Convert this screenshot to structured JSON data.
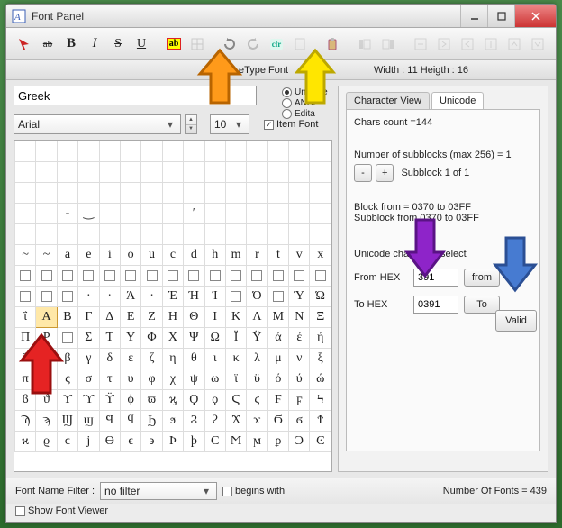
{
  "window": {
    "title": "Font Panel"
  },
  "infobar": {
    "center_label": "eType Font",
    "dims": "Width : 11  Heigth : 16"
  },
  "toolbar_glyphs": {
    "cross_ab": "ab",
    "clr": "clr"
  },
  "left": {
    "block_name": "Greek",
    "font_family": "Arial",
    "font_size": "10",
    "radios": {
      "unicode": "Unicode",
      "ansi": "ANSI",
      "editable": "Edita"
    },
    "item_font_label": "Item Font",
    "item_font_checked": true
  },
  "tabs": {
    "char_view": "Character View",
    "unicode": "Unicode"
  },
  "right": {
    "chars_count_label": "Chars count =",
    "chars_count_value": "144",
    "subblocks_label": "Number of subblocks (max 256)  =",
    "subblocks_value": "1",
    "subblock_text": "Subblock 1 of 1",
    "block_range": "Block from = 0370 to 03FF",
    "subblock_range": "Subblock from 0370 to 03FF",
    "class_select_label": "Unicode char class select",
    "from_hex_label": "From HEX",
    "from_hex_value": "391",
    "from_btn": "from",
    "to_hex_label": "To HEX",
    "to_hex_value": "0391",
    "to_btn": "To",
    "valid_btn": "Valid"
  },
  "bottom": {
    "font_filter_label": "Font Name Filter :",
    "filter_value": "no filter",
    "begins_with": "begins with",
    "num_fonts_label": "Number Of Fonts =",
    "num_fonts_value": "439",
    "show_font_viewer": "Show Font Viewer"
  },
  "grid_rows": [
    [
      "",
      "",
      "",
      "",
      "",
      "",
      "",
      "",
      "",
      "",
      "",
      "",
      "",
      "",
      ""
    ],
    [
      "",
      "",
      "",
      "",
      "",
      "",
      "",
      "",
      "",
      "",
      "",
      "",
      "",
      "",
      ""
    ],
    [
      "",
      "",
      "",
      "",
      "",
      "",
      "",
      "",
      "",
      "",
      "",
      "",
      "",
      "",
      ""
    ],
    [
      "",
      "",
      "-",
      "‿",
      "",
      "",
      "",
      "",
      "′",
      "",
      "",
      "",
      "",
      "",
      ""
    ],
    [
      "",
      "",
      "",
      "",
      "",
      "",
      "",
      "",
      "",
      "",
      "",
      "",
      "",
      "",
      ""
    ],
    [
      "~",
      "~",
      "a",
      "e",
      "i",
      "o",
      "u",
      "c",
      "d",
      "h",
      "m",
      "r",
      "t",
      "v",
      "x"
    ],
    [
      "□",
      "□",
      "□",
      "□",
      "□",
      "□",
      "□",
      "□",
      "□",
      "□",
      "□",
      "□",
      "□",
      "□",
      "□"
    ],
    [
      "□",
      "□",
      "□",
      "·",
      "·",
      "Ά",
      "·",
      "Έ",
      "Ή",
      "Ί",
      "□",
      "Ό",
      "□",
      "Ύ",
      "Ώ"
    ],
    [
      "ΐ",
      "A",
      "Β",
      "Γ",
      "Δ",
      "Ε",
      "Ζ",
      "Η",
      "Θ",
      "Ι",
      "Κ",
      "Λ",
      "Μ",
      "Ν",
      "Ξ"
    ],
    [
      "Π",
      "Ρ",
      "□",
      "Σ",
      "Τ",
      "Υ",
      "Φ",
      "Χ",
      "Ψ",
      "Ω",
      "Ϊ",
      "Ϋ",
      "ά",
      "έ",
      "ή"
    ],
    [
      "ΰ",
      "α",
      "β",
      "γ",
      "δ",
      "ε",
      "ζ",
      "η",
      "θ",
      "ι",
      "κ",
      "λ",
      "μ",
      "ν",
      "ξ"
    ],
    [
      "π",
      "ρ",
      "ς",
      "σ",
      "τ",
      "υ",
      "φ",
      "χ",
      "ψ",
      "ω",
      "ϊ",
      "ϋ",
      "ό",
      "ύ",
      "ώ"
    ],
    [
      "ϐ",
      "ϑ",
      "ϒ",
      "ϓ",
      "ϔ",
      "ϕ",
      "ϖ",
      "ϗ",
      "Ϙ",
      "ϙ",
      "Ϛ",
      "ϛ",
      "Ϝ",
      "ϝ",
      "Ϟ"
    ],
    [
      "Ϡ",
      "ϡ",
      "Ϣ",
      "ϣ",
      "Ϥ",
      "ϥ",
      "Ϧ",
      "ϧ",
      "Ϩ",
      "ϩ",
      "Ϫ",
      "ϫ",
      "Ϭ",
      "ϭ",
      "Ϯ"
    ],
    [
      "ϰ",
      "ϱ",
      "ϲ",
      "ϳ",
      "ϴ",
      "ϵ",
      "϶",
      "Ϸ",
      "ϸ",
      "Ϲ",
      "Ϻ",
      "ϻ",
      "ϼ",
      "Ͻ",
      "Ͼ"
    ]
  ],
  "selected_cell": {
    "row": 8,
    "col": 1
  }
}
